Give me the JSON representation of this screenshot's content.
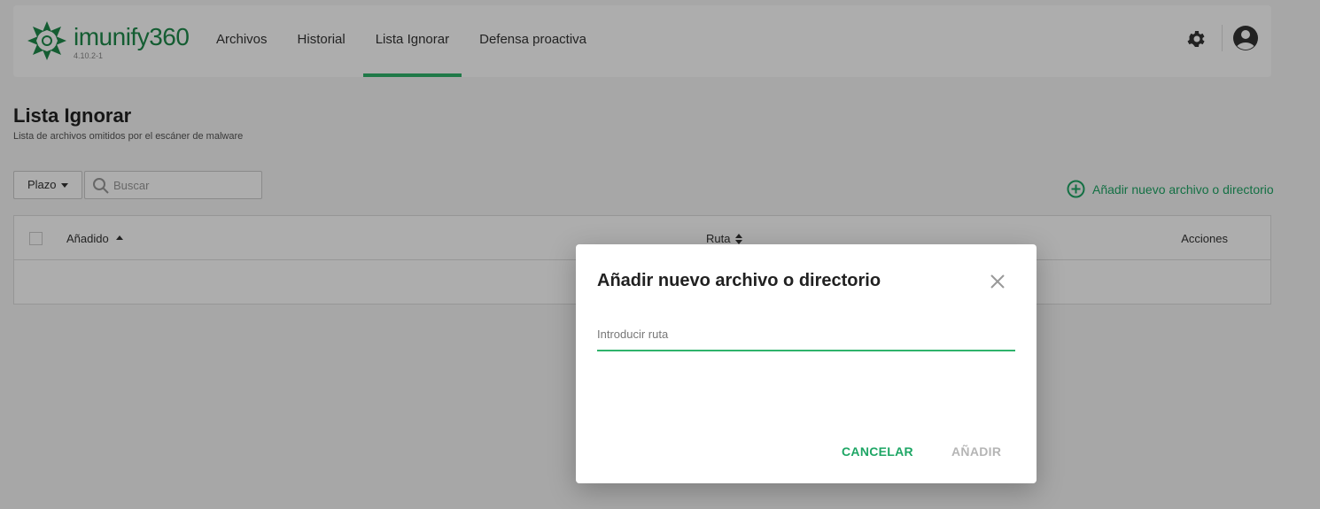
{
  "header": {
    "logo_text": "imunify360",
    "version": "4.10.2-1",
    "nav": [
      {
        "label": "Archivos",
        "active": false
      },
      {
        "label": "Historial",
        "active": false
      },
      {
        "label": "Lista Ignorar",
        "active": true
      },
      {
        "label": "Defensa proactiva",
        "active": false
      }
    ],
    "icons": [
      "gear-icon",
      "avatar-icon"
    ]
  },
  "page": {
    "title": "Lista Ignorar",
    "subtitle": "Lista de archivos omitidos por el escáner de malware"
  },
  "toolbar": {
    "filter_label": "Plazo",
    "search_placeholder": "Buscar",
    "add_link_label": "Añadir nuevo archivo o directorio"
  },
  "table": {
    "columns": [
      "Añadido",
      "Ruta",
      "Acciones"
    ]
  },
  "modal": {
    "title": "Añadir nuevo archivo o directorio",
    "input_placeholder": "Introducir ruta",
    "input_value": "",
    "cancel_label": "CANCELAR",
    "submit_label": "AÑADIR"
  },
  "colors": {
    "brand_green": "#1e8a4b",
    "accent_green": "#2fb36b",
    "link_green": "#1ea665",
    "disabled": "#b5b5b5"
  }
}
